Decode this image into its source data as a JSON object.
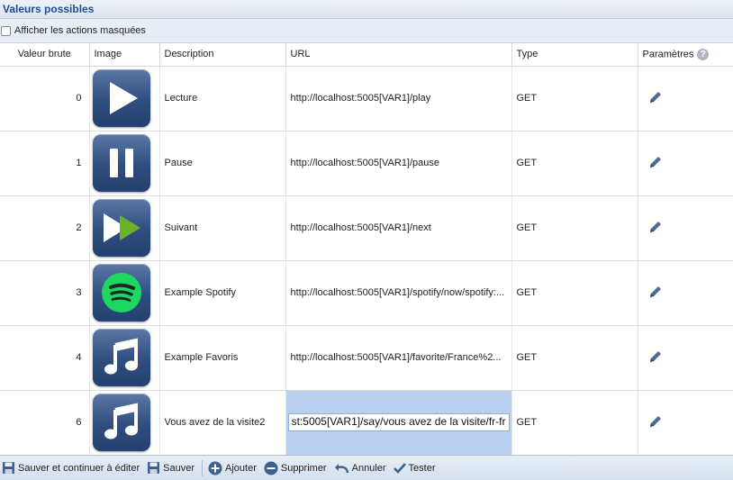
{
  "panel": {
    "title": "Valeurs possibles"
  },
  "options": {
    "show_hidden_label": "Afficher les actions masquées",
    "show_hidden_checked": false
  },
  "columns": {
    "raw_value": "Valeur brute",
    "image": "Image",
    "description": "Description",
    "url": "URL",
    "type": "Type",
    "params": "Paramètres"
  },
  "rows": [
    {
      "value": "0",
      "icon": "play-icon",
      "description": "Lecture",
      "url": "http://localhost:5005[VAR1]/play",
      "type": "GET"
    },
    {
      "value": "1",
      "icon": "pause-icon",
      "description": "Pause",
      "url": "http://localhost:5005[VAR1]/pause",
      "type": "GET"
    },
    {
      "value": "2",
      "icon": "next-icon",
      "description": "Suivant",
      "url": "http://localhost:5005[VAR1]/next",
      "type": "GET"
    },
    {
      "value": "3",
      "icon": "spotify-icon",
      "description": "Example Spotify",
      "url": "http://localhost:5005[VAR1]/spotify/now/spotify:...",
      "type": "GET"
    },
    {
      "value": "4",
      "icon": "music-note-icon",
      "description": "Example Favoris",
      "url": "http://localhost:5005[VAR1]/favorite/France%2...",
      "type": "GET"
    },
    {
      "value": "6",
      "icon": "music-note-icon",
      "description": "Vous avez de la visite2",
      "url": "st:5005[VAR1]/say/vous avez de la visite/fr-fr",
      "type": "GET",
      "editing": true
    }
  ],
  "toolbar": {
    "save_continue": "Sauver et continuer à éditer",
    "save": "Sauver",
    "add": "Ajouter",
    "delete": "Supprimer",
    "undo": "Annuler",
    "test": "Tester"
  },
  "colors": {
    "accent": "#1d4e8f",
    "tile": "#2f4d7f",
    "selection": "#b9d1ee",
    "spotify": "#1ed760",
    "next_arrow": "#6ab42d"
  }
}
